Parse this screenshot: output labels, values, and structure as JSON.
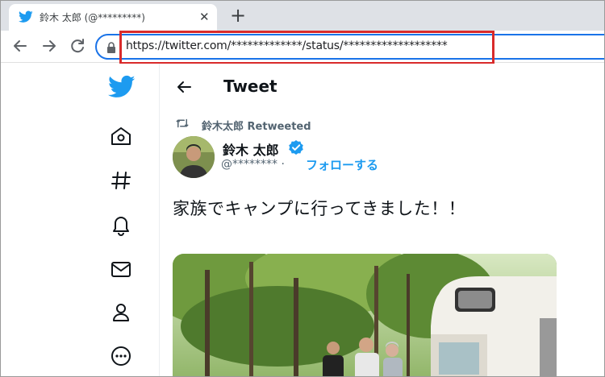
{
  "browser": {
    "tab_title": "鈴木 太郎 (@*********)",
    "tab_close": "✕",
    "new_tab": "+",
    "url": "https://twitter.com/*************/status/*******************"
  },
  "header": {
    "title": "Tweet"
  },
  "tweet": {
    "retweet_label": "鈴木太郎 Retweeted",
    "author_name": "鈴木 太郎",
    "handle": "@******** ·",
    "follow_label": "フォローする",
    "text": "家族でキャンプに行ってきました！！"
  },
  "colors": {
    "twitter_blue": "#1d9bf0",
    "highlight_red": "#d92b2b",
    "omnibox_blue": "#1a73e8"
  },
  "icons": {
    "sidebar": [
      "twitter-logo-icon",
      "home-icon",
      "explore-hash-icon",
      "notifications-bell-icon",
      "messages-mail-icon",
      "profile-person-icon",
      "more-circle-icon"
    ],
    "toolbar": [
      "back-icon",
      "forward-icon",
      "reload-icon",
      "lock-icon"
    ]
  }
}
